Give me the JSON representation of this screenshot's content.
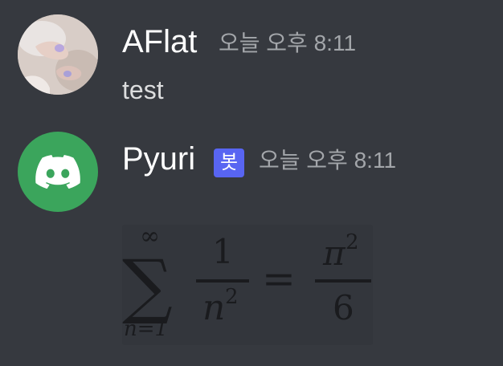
{
  "messages": [
    {
      "username": "AFlat",
      "timestamp": "오늘 오후 8:11",
      "content": "test",
      "avatar_icon": "user-photo-avatar"
    },
    {
      "username": "Pyuri",
      "bot_tag": "봇",
      "timestamp": "오늘 오후 8:11",
      "avatar_icon": "discord-logo-icon",
      "avatar_color": "#3ba55c",
      "attachment": {
        "type": "latex-image",
        "sum_upper": "∞",
        "sum_symbol": "∑",
        "sum_lower": "n=1",
        "frac_num": "1",
        "frac_den": "n",
        "frac_den_exp": "2",
        "equals": "=",
        "rhs_num": "π",
        "rhs_num_exp": "2",
        "rhs_den": "6"
      }
    }
  ],
  "colors": {
    "background": "#36393f",
    "username": "#ffffff",
    "timestamp": "#a3a6aa",
    "text": "#dcddde",
    "bot_tag": "#5865f2"
  }
}
